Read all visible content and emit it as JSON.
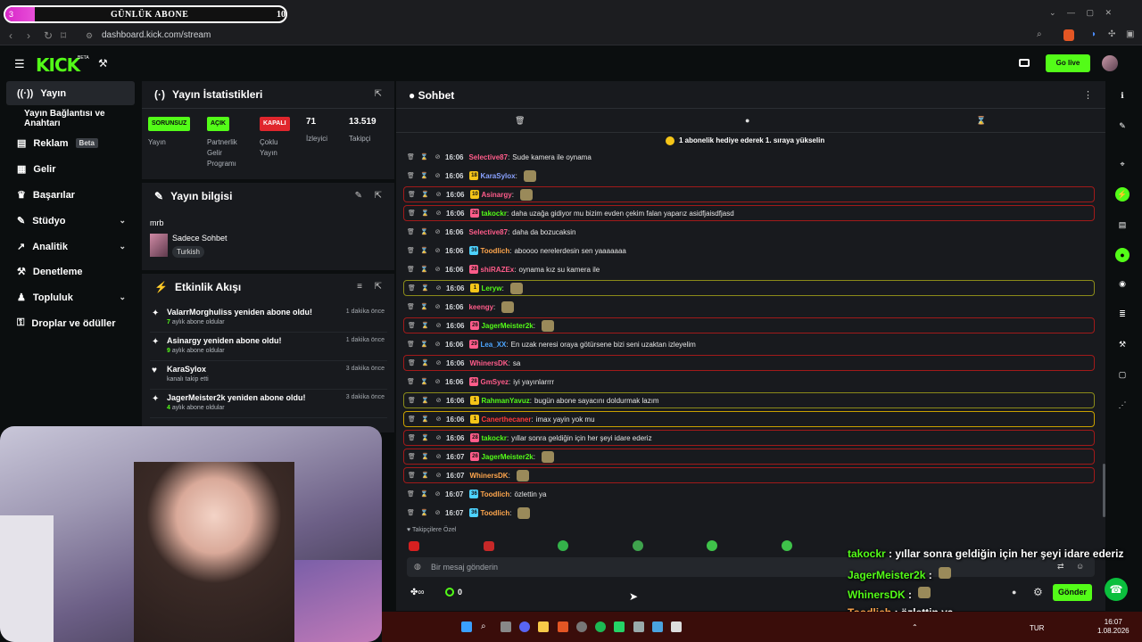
{
  "browser": {
    "url": "dashboard.kick.com/stream",
    "tab_fragment": "oard"
  },
  "sub_goal": {
    "current": "3",
    "label": "GÜNLÜK ABONE",
    "target": "10",
    "progress": 0.3
  },
  "app": {
    "logo": "KICK",
    "beta": "BETA",
    "go_live": "Go live"
  },
  "sidebar": {
    "items": [
      {
        "label": "Yayın",
        "icon": "broadcast-icon",
        "active": true
      },
      {
        "label": "Yayın Bağlantısı ve Anahtarı",
        "icon": "",
        "active": false
      },
      {
        "label": "Reklam",
        "icon": "ads-icon",
        "badge": "Beta"
      },
      {
        "label": "Gelir",
        "icon": "revenue-icon"
      },
      {
        "label": "Başarılar",
        "icon": "trophy-icon"
      },
      {
        "label": "Stüdyo",
        "icon": "studio-icon",
        "expandable": true
      },
      {
        "label": "Analitik",
        "icon": "analytics-icon",
        "expandable": true
      },
      {
        "label": "Denetleme",
        "icon": "hammer-icon"
      },
      {
        "label": "Topluluk",
        "icon": "community-icon",
        "expandable": true
      },
      {
        "label": "Droplar ve ödüller",
        "icon": "drops-icon"
      }
    ]
  },
  "stats": {
    "title": "Yayın İstatistikleri",
    "items": [
      {
        "tag": "SORUNSUZ",
        "label": "Yayın"
      },
      {
        "tag": "AÇIK",
        "label": "Partnerlik Gelir Programı"
      },
      {
        "tag": "KAPALI",
        "label": "Çoklu Yayın"
      },
      {
        "value": "71",
        "label": "İzleyici"
      },
      {
        "value": "13.519",
        "label": "Takipçi"
      }
    ]
  },
  "stream_info": {
    "title": "Yayın bilgisi",
    "stream_title": "mrb",
    "category": "Sadece Sohbet",
    "language": "Turkish"
  },
  "activity": {
    "title": "Etkinlik Akışı",
    "events": [
      {
        "title": "ValarrMorghuliss yeniden abone oldu!",
        "count": "7",
        "sub": "aylık abone oldular",
        "time": "1 dakika önce"
      },
      {
        "title": "Asinargy yeniden abone oldu!",
        "count": "9",
        "sub": "aylık abone oldular",
        "time": "1 dakika önce"
      },
      {
        "title": "KaraSylox",
        "count": "",
        "sub": "kanalı takip etti",
        "time": "3 dakika önce"
      },
      {
        "title": "JagerMeister2k yeniden abone oldu!",
        "count": "4",
        "sub": "aylık abone oldular",
        "time": "3 dakika önce"
      }
    ]
  },
  "chat": {
    "title": "Sohbet",
    "pinned": "1 abonelik hediye ederek 1. sıraya yükselin",
    "followers_only": "Takipçilere Özel",
    "input_placeholder": "Bir mesaj gönderin",
    "send": "Gönder",
    "points": "0",
    "messages": [
      {
        "time": "16:06",
        "user": "Selective87",
        "color": "#ff5c8a",
        "text": "Sude kamera ile oynama",
        "style": ""
      },
      {
        "time": "16:06",
        "user": "KaraSylox",
        "color": "#8aa2ff",
        "text": "",
        "style": "",
        "badge": "18"
      },
      {
        "time": "16:06",
        "user": "Asinargy",
        "color": "#ff5c8a",
        "text": "",
        "style": "red",
        "badge": "10"
      },
      {
        "time": "16:06",
        "user": "takockr",
        "color": "#53fc18",
        "text": "daha uzağa gidiyor mu bizim evden çekim falan yaparız asidfjaisdfjasd",
        "style": "red",
        "badge": "28"
      },
      {
        "time": "16:06",
        "user": "Selective87",
        "color": "#ff5c8a",
        "text": "daha da bozucaksin",
        "style": ""
      },
      {
        "time": "16:06",
        "user": "Toodlich",
        "color": "#ffa64d",
        "text": "aboooo nerelerdesin sen yaaaaaaa",
        "style": "",
        "badge": "36"
      },
      {
        "time": "16:06",
        "user": "shiRAZEx",
        "color": "#ff5c8a",
        "text": "oynama kız su kamera ile",
        "style": "",
        "badge": "28"
      },
      {
        "time": "16:06",
        "user": "Leryw",
        "color": "#53fc18",
        "text": "",
        "style": "yel",
        "badge": "1"
      },
      {
        "time": "16:06",
        "user": "keengy",
        "color": "#ff5c8a",
        "text": "",
        "style": ""
      },
      {
        "time": "16:06",
        "user": "JagerMeister2k",
        "color": "#53fc18",
        "text": "",
        "style": "red",
        "badge": "26"
      },
      {
        "time": "16:06",
        "user": "Lea_XX",
        "color": "#4da6ff",
        "text": "En uzak neresi oraya götürsene bizi seni uzaktan izleyelim",
        "style": "",
        "badge": "29"
      },
      {
        "time": "16:06",
        "user": "WhinersDK",
        "color": "#ff5c8a",
        "text": "sa",
        "style": "red"
      },
      {
        "time": "16:06",
        "user": "GmSyez",
        "color": "#ff5c8a",
        "text": "iyi yayınlarrrr",
        "style": "",
        "badge": "28"
      },
      {
        "time": "16:06",
        "user": "RahmanYavuz",
        "color": "#53fc18",
        "text": "bugün abone sayacını doldurmak lazım",
        "style": "yel",
        "badge": "1"
      },
      {
        "time": "16:06",
        "user": "Canerthecaner",
        "color": "#ff3a3a",
        "text": "imax yayin yok mu",
        "style": "gold",
        "badge": "1"
      },
      {
        "time": "16:06",
        "user": "takockr",
        "color": "#53fc18",
        "text": "yıllar sonra geldiğin için her şeyi idare ederiz",
        "style": "red",
        "badge": "28"
      },
      {
        "time": "16:07",
        "user": "JagerMeister2k",
        "color": "#53fc18",
        "text": "",
        "style": "red",
        "badge": "26"
      },
      {
        "time": "16:07",
        "user": "WhinersDK",
        "color": "#ffa64d",
        "text": "",
        "style": "red"
      },
      {
        "time": "16:07",
        "user": "Toodlich",
        "color": "#ffa64d",
        "text": "özlettin ya",
        "style": "",
        "badge": "36"
      },
      {
        "time": "16:07",
        "user": "Toodlich",
        "color": "#ffa64d",
        "text": "",
        "style": "",
        "badge": "36"
      }
    ]
  },
  "overlay_chat": [
    {
      "user": "takockr",
      "color": "#53fc18",
      "text": "yıllar sonra geldiğin için her şeyi idare ederiz"
    },
    {
      "user": "JagerMeister2k",
      "color": "#53fc18",
      "text": ""
    },
    {
      "user": "WhinersDK",
      "color": "#53fc18",
      "text": ""
    },
    {
      "user": "Toodlich",
      "color": "#ffa64d",
      "text": "özlettin ya"
    },
    {
      "user": "Toodlich",
      "color": "#ffa64d",
      "text": ""
    }
  ],
  "taskbar": {
    "lang": "TUR",
    "time": "16:07",
    "date": "1.08.2026"
  },
  "colors": {
    "accent": "#53fc18",
    "panel": "#181a1e",
    "bg": "#0b0e0f"
  }
}
